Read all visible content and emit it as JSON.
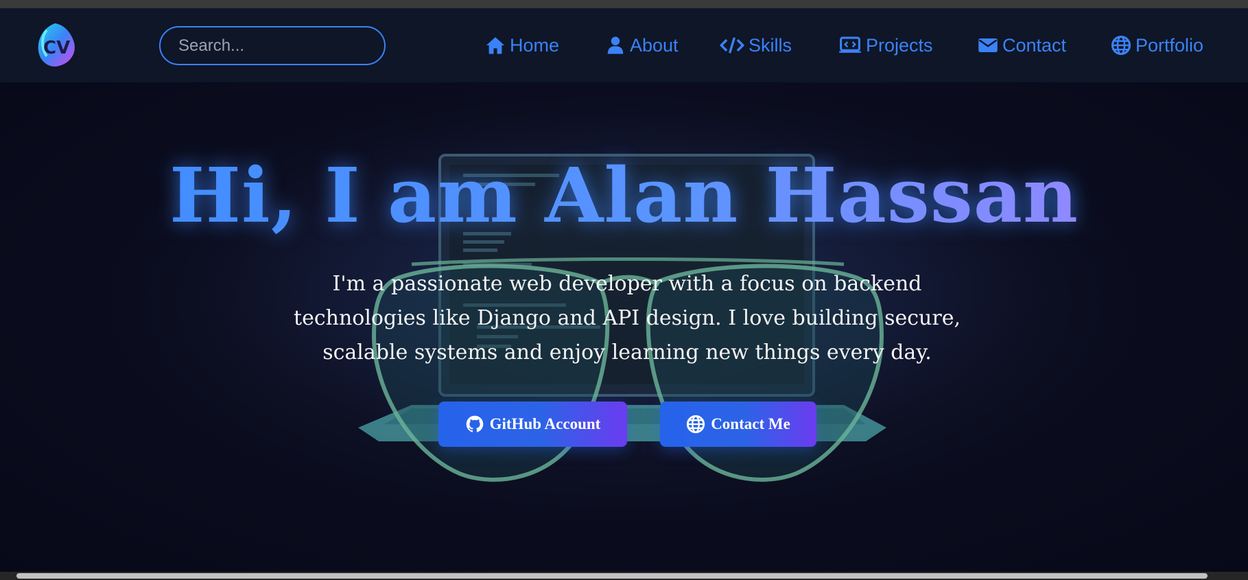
{
  "nav": {
    "search_placeholder": "Search...",
    "items": [
      {
        "label": "Home",
        "icon": "home-icon"
      },
      {
        "label": "About",
        "icon": "user-icon"
      },
      {
        "label": "Skills",
        "icon": "code-icon"
      },
      {
        "label": "Projects",
        "icon": "laptop-code-icon"
      },
      {
        "label": "Contact",
        "icon": "envelope-icon"
      },
      {
        "label": "Portfolio",
        "icon": "globe-icon"
      }
    ]
  },
  "hero": {
    "title": "Hi, I am Alan Hassan",
    "description": "I'm a passionate web developer with a focus on backend technologies like Django and API design. I love building secure, scalable systems and enjoy learning new things every day.",
    "buttons": [
      {
        "label": "GitHub Account",
        "icon": "github-icon"
      },
      {
        "label": "Contact Me",
        "icon": "globe-icon"
      }
    ]
  },
  "colors": {
    "accent": "#3b82f6",
    "navbar_bg": "#0e1628",
    "title_gradient": [
      "#3b8bff",
      "#a684ff"
    ],
    "button_gradient": [
      "#2563eb",
      "#6b3cf0"
    ]
  }
}
